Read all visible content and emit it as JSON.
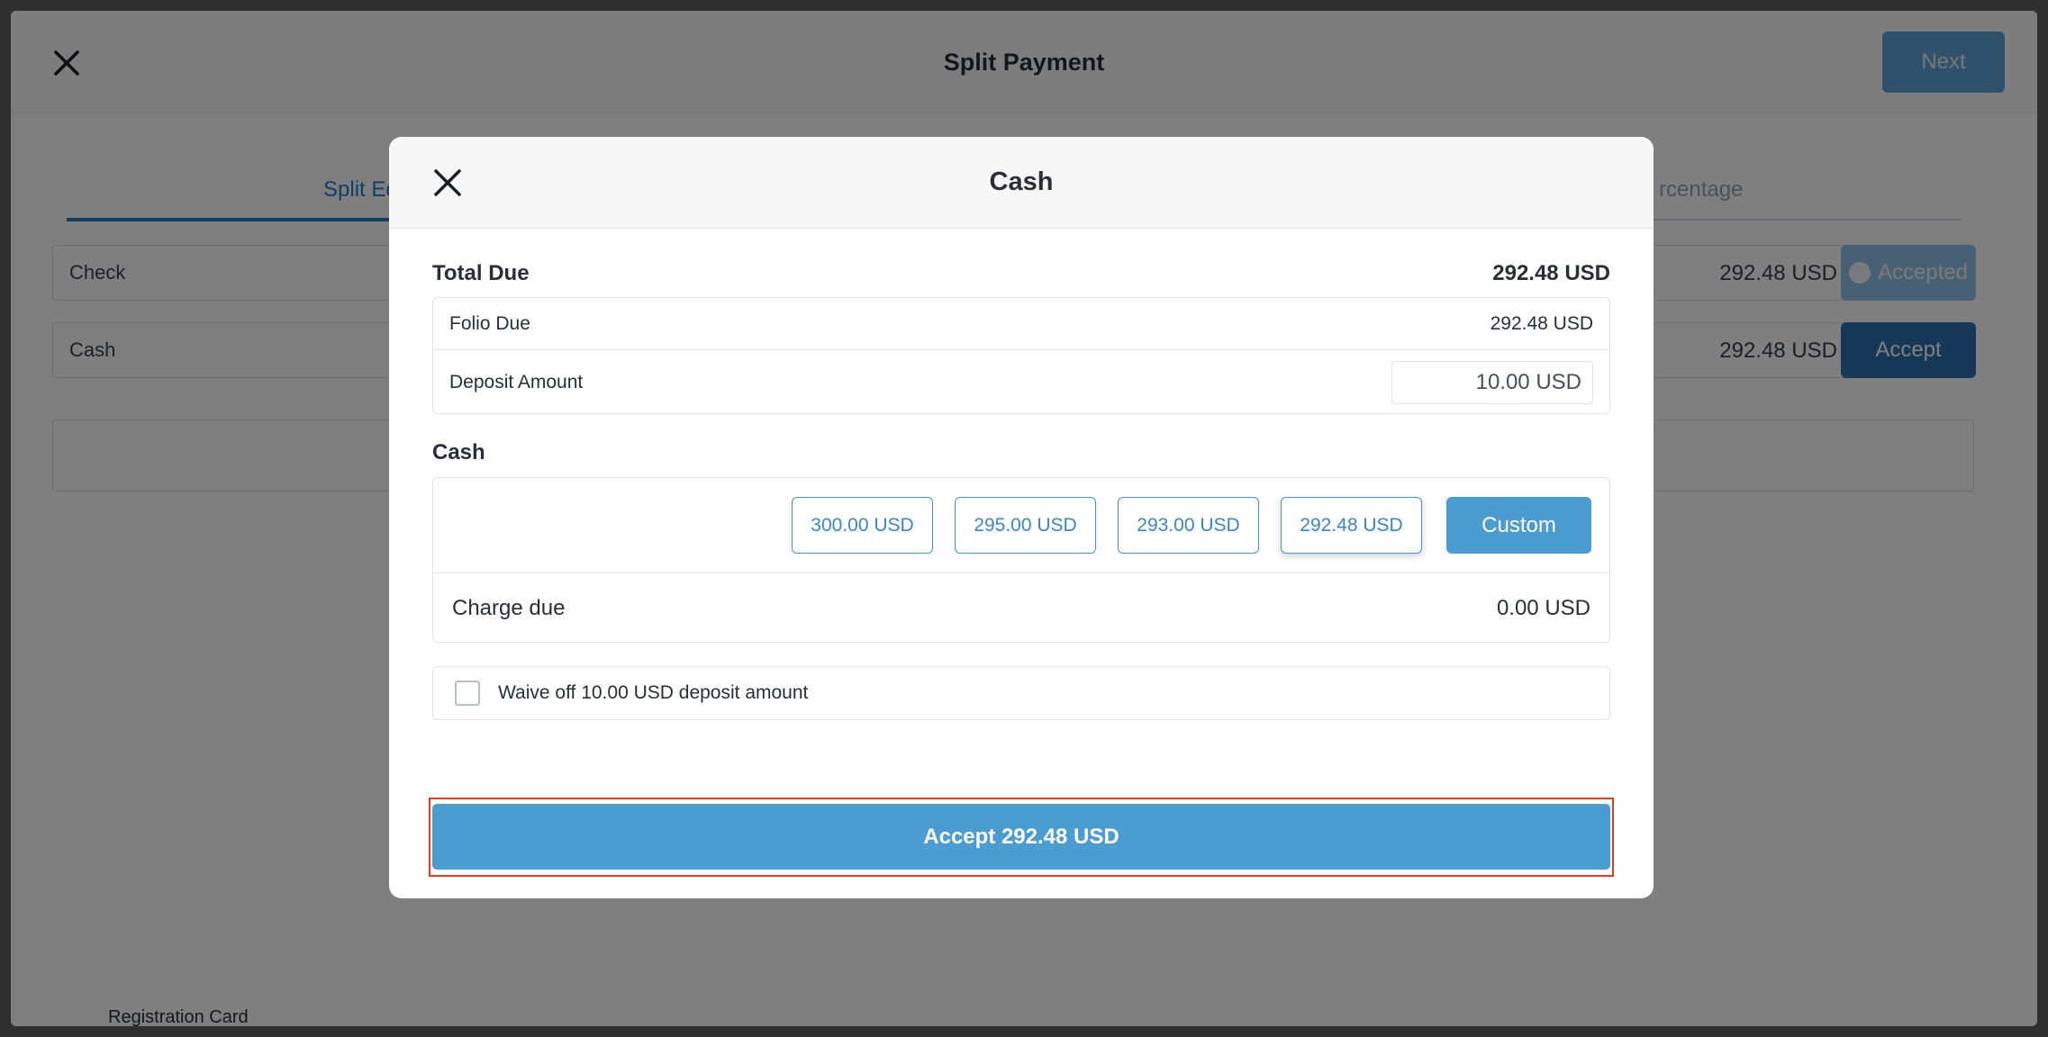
{
  "background": {
    "title": "Split Payment",
    "next_label": "Next",
    "tab_left": "Split Eq",
    "tab_right": "rcentage",
    "rows": [
      {
        "method": "Check",
        "amount": "292.48 USD",
        "action": "Accepted"
      },
      {
        "method": "Cash",
        "amount": "292.48 USD",
        "action": "Accept"
      }
    ],
    "footer_text": "Registration Card"
  },
  "modal": {
    "title": "Cash",
    "total_due_label": "Total Due",
    "total_due_value": "292.48 USD",
    "folio_due_label": "Folio Due",
    "folio_due_value": "292.48 USD",
    "deposit_label": "Deposit Amount",
    "deposit_value": "10.00 USD",
    "cash_section_label": "Cash",
    "cash_options": [
      "300.00 USD",
      "295.00 USD",
      "293.00 USD",
      "292.48 USD"
    ],
    "selected_option": "292.48 USD",
    "custom_label": "Custom",
    "charge_due_label": "Charge due",
    "charge_due_value": "0.00 USD",
    "waive_label": "Waive off 10.00 USD deposit amount",
    "waive_checked": false,
    "accept_label": "Accept 292.48 USD"
  },
  "colors": {
    "primary": "#4b9cd0",
    "highlight": "#e03b24",
    "overlay": "rgba(0,0,0,0.5)"
  }
}
